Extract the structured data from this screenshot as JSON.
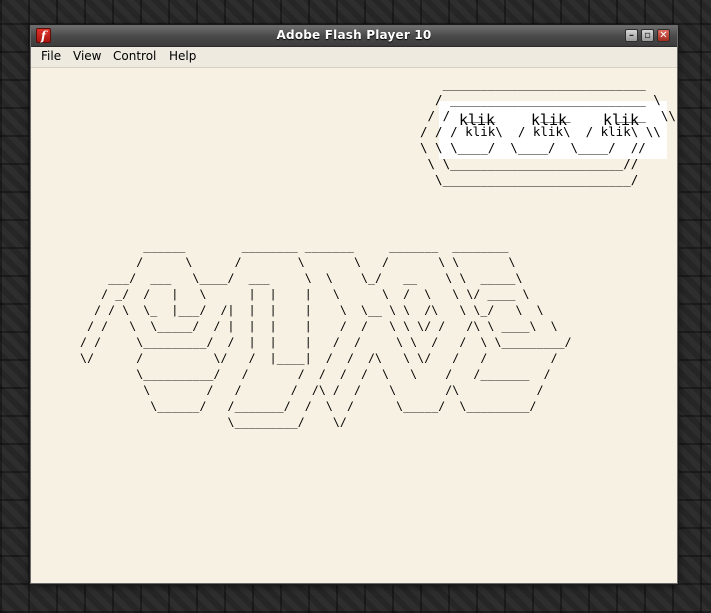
{
  "window": {
    "title": "Adobe Flash Player 10",
    "icon": "flash-icon",
    "app_icon_glyph": "f",
    "controls": {
      "minimize": "–",
      "maximize": "▫",
      "close": "✕"
    }
  },
  "menu": {
    "items": [
      "File",
      "View",
      "Control",
      "Help"
    ]
  },
  "button_panel": {
    "art": "   ___________________________\n  / __________________________ \\\n / /  ____      ____      ____  \\\\\n/ / / klik\\  / klik\\  / klik\\ \\\\\n\\ \\ \\____/  \\____/  \\____/  //\n \\ \\_______________________// \n  \\_________________________/",
    "buttons": [
      "klik",
      "klik",
      "klik"
    ]
  },
  "logo": {
    "art": "           ______        ________ _______     _______  ________\n          /      \\      /        \\       \\   /       \\ \\       \\\n      ___/  ___   \\____/  ___     \\  \\    \\_/   __    \\ \\  _____\\\n     / _/  /   |   \\      |  |    |   \\      \\  /  \\   \\ \\/ ____ \\\n    / / \\  \\_  |___/  /|  |  |    |    \\  \\__ \\ \\  /\\   \\ \\_/   \\  \\\n   / /   \\  \\_____/  / |  |  |    |    /  /   \\ \\ \\/ /   /\\ \\ ____\\  \\\n  / /     \\_________/  /  |  |    |   /  /     \\ \\  /   /  \\ \\_________/\n  \\/      /          \\/   /  |____|  /  /  /\\   \\ \\/   /   /         /\n          \\__________/   /       /  /  /  /  \\   \\    /   /_______  /\n           \\        /   /       /  /\\ /  /    \\       /\\           /\n            \\______/   /_______/  /  \\  /      \\_____/  \\_________/\n                       \\_________/    \\/"
  }
}
